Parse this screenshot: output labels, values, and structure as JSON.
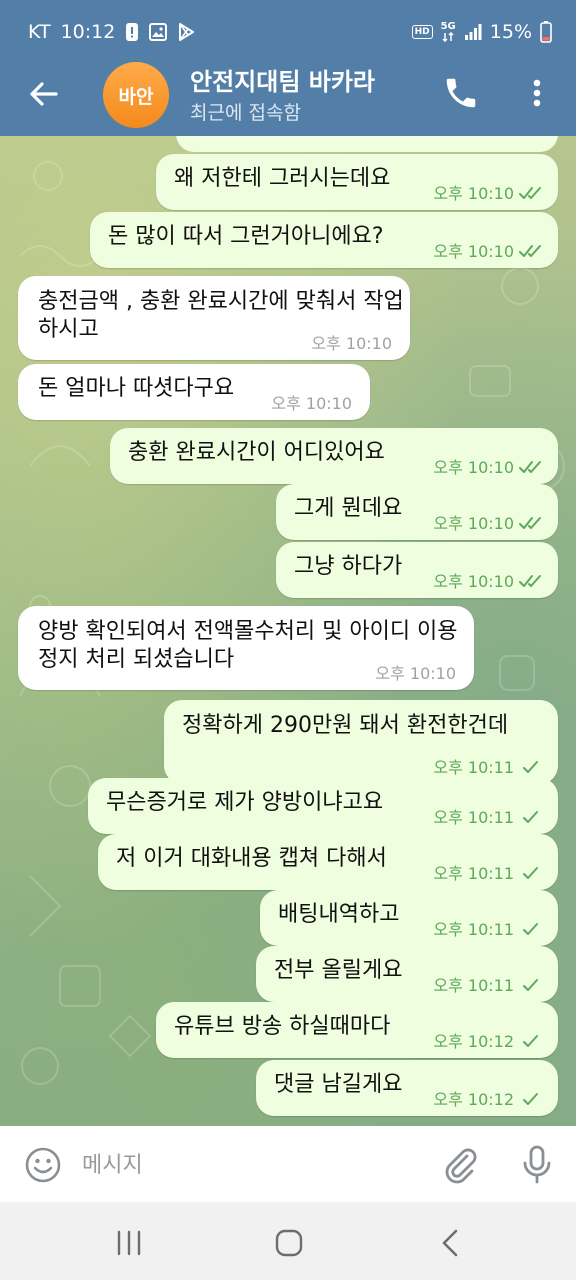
{
  "status_bar": {
    "carrier": "KT",
    "time": "10:12",
    "network": "5G",
    "battery": "15%",
    "hd_label": "HD"
  },
  "header": {
    "avatar_text": "바안",
    "title": "안전지대팀 바카라",
    "subtitle": "최근에 접속함"
  },
  "messages": [
    {
      "dir": "out",
      "text": "왜 저한테 그러시는데요",
      "time": "오후 10:10",
      "status": "read"
    },
    {
      "dir": "out",
      "text": "돈 많이 따서 그런거아니에요?",
      "time": "오후 10:10",
      "status": "read"
    },
    {
      "dir": "in",
      "text": "충전금액 , 충환 완료시간에 맞춰서 작업하시고",
      "time": "오후 10:10"
    },
    {
      "dir": "in",
      "text": "돈 얼마나 따셧다구요",
      "time": "오후 10:10"
    },
    {
      "dir": "out",
      "text": "충환 완료시간이 어디있어요",
      "time": "오후 10:10",
      "status": "read"
    },
    {
      "dir": "out",
      "text": "그게 뭔데요",
      "time": "오후 10:10",
      "status": "read"
    },
    {
      "dir": "out",
      "text": "그냥 하다가",
      "time": "오후 10:10",
      "status": "read"
    },
    {
      "dir": "in",
      "text": "양방 확인되여서 전액몰수처리 및 아이디 이용정지 처리 되셨습니다",
      "time": "오후 10:10"
    },
    {
      "dir": "out",
      "text": "정확하게 290만원 돼서 환전한건데",
      "time": "오후 10:11",
      "status": "sent"
    },
    {
      "dir": "out",
      "text": "무슨증거로 제가 양방이냐고요",
      "time": "오후 10:11",
      "status": "sent"
    },
    {
      "dir": "out",
      "text": "저 이거 대화내용 캡쳐 다해서",
      "time": "오후 10:11",
      "status": "sent"
    },
    {
      "dir": "out",
      "text": "배팅내역하고",
      "time": "오후 10:11",
      "status": "sent"
    },
    {
      "dir": "out",
      "text": "전부 올릴게요",
      "time": "오후 10:11",
      "status": "sent"
    },
    {
      "dir": "out",
      "text": "유튜브 방송 하실때마다",
      "time": "오후 10:12",
      "status": "sent"
    },
    {
      "dir": "out",
      "text": "댓글 남길게요",
      "time": "오후 10:12",
      "status": "sent"
    }
  ],
  "input": {
    "placeholder": "메시지"
  },
  "colors": {
    "header": "#537ea8",
    "outgoing_bubble": "#eefedf",
    "incoming_bubble": "#ffffff",
    "outgoing_time": "#5fa85c",
    "incoming_time": "#a2a2a2",
    "avatar": "#f6911f"
  },
  "icons": [
    "back-arrow-icon",
    "phone-icon",
    "more-vert-icon",
    "emoji-icon",
    "attach-icon",
    "mic-icon",
    "double-check-icon",
    "check-icon"
  ]
}
